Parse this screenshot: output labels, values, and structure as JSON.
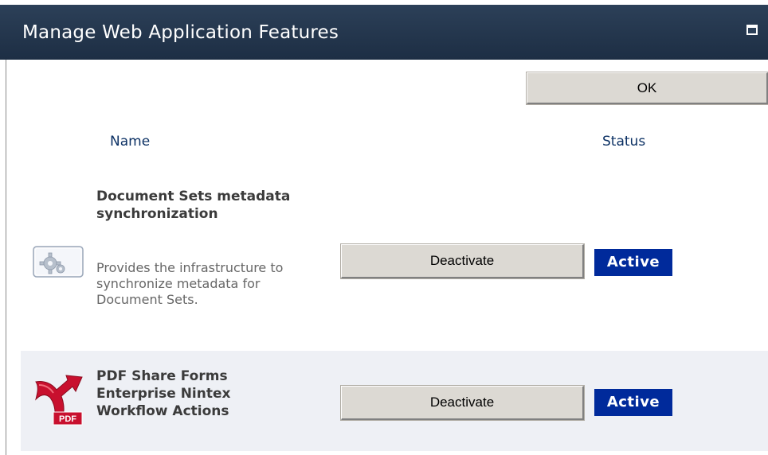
{
  "dialog": {
    "title": "Manage Web Application Features"
  },
  "toolbar": {
    "ok_label": "OK"
  },
  "table": {
    "headers": {
      "name": "Name",
      "status": "Status"
    }
  },
  "features": [
    {
      "title": "Document Sets metadata synchronization",
      "description": "Provides the infrastructure to synchronize metadata for Document Sets.",
      "button_label": "Deactivate",
      "status": "Active",
      "icon": "feature-gear-icon"
    },
    {
      "title": "PDF Share Forms Enterprise Nintex Workflow Actions",
      "description": "",
      "button_label": "Deactivate",
      "status": "Active",
      "icon": "pdf-share-forms-icon",
      "icon_text": "PDF"
    }
  ],
  "colors": {
    "titlebar": "#1d2e44",
    "header_text": "#0c3164",
    "status_badge": "#002a9b",
    "alt_row": "#eef0f5"
  }
}
